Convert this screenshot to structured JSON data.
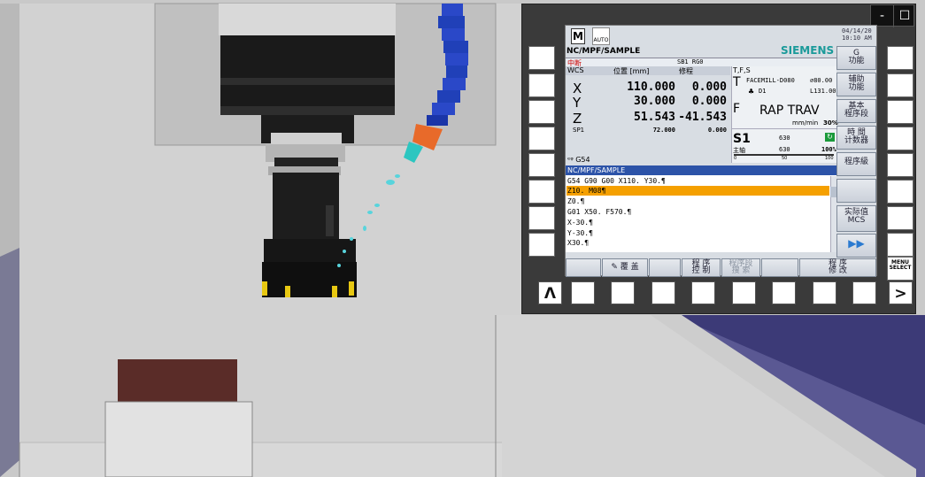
{
  "window": {
    "minimize_label": "-",
    "maximize_label": "☐"
  },
  "hmi": {
    "mode_icon": "M",
    "auto_label": "AUTO",
    "date": "04/14/20",
    "time": "10:10 AM",
    "program_path": "NC/MPF/SAMPLE",
    "brand": "SIEMENS",
    "status_text": "中断",
    "channel_text": "SB1 RG0",
    "coord_header": {
      "wcs": "WCS",
      "position": "位置 [mm]",
      "offset": "修程"
    },
    "axes": [
      {
        "name": "X",
        "position": "110.000",
        "dist": "0.000"
      },
      {
        "name": "Y",
        "position": "30.000",
        "dist": "0.000"
      },
      {
        "name": "Z",
        "position": "51.543",
        "dist": "-41.543"
      }
    ],
    "spindle": {
      "name": "SP1",
      "position": "72.000",
      "dist": "0.000"
    },
    "tfs": {
      "header": "T,F,S",
      "tool_letter": "T",
      "tool_name": "FACEMILL-D080",
      "tool_diameter": "⌀80.00",
      "d_label": "D1",
      "tool_length": "L131.00",
      "feed_letter": "F",
      "feed_value": "RAP TRAV",
      "feed_unit": "mm/min",
      "feed_override": "30%",
      "spindle_letter": "S1",
      "spindle_value": "630",
      "spindle_main": "主轴",
      "spindle_actual": "630",
      "spindle_override": "100%",
      "scale_0": "0",
      "scale_50": "50",
      "scale_100": "100"
    },
    "frame": "G54",
    "prog_header": "NC/MPF/SAMPLE",
    "program_lines": [
      "G54 G90 G00 X110. Y30.¶",
      "Z10. M08¶",
      "Z0.¶",
      "G01 X50. F570.¶",
      "X-30.¶",
      "Y-30.¶",
      "X30.¶"
    ],
    "active_line": 1,
    "vertical_softkeys": [
      "G\n功能",
      "辅助\n功能",
      "基本\n程序段",
      "時 間\n计数器",
      "程序級",
      "",
      "",
      "实际值\nMCS",
      "▶▶"
    ],
    "horizontal_softkeys": [
      "",
      "覆 盖",
      "",
      "程 序\n控 制",
      "程序段\n搜 索",
      "",
      "程 序\n修 改"
    ],
    "menu_select": "MENU\nSELECT",
    "back_label": "Λ",
    "next_label": ">",
    "overlay_frame": "ᵉᵠ G54"
  }
}
